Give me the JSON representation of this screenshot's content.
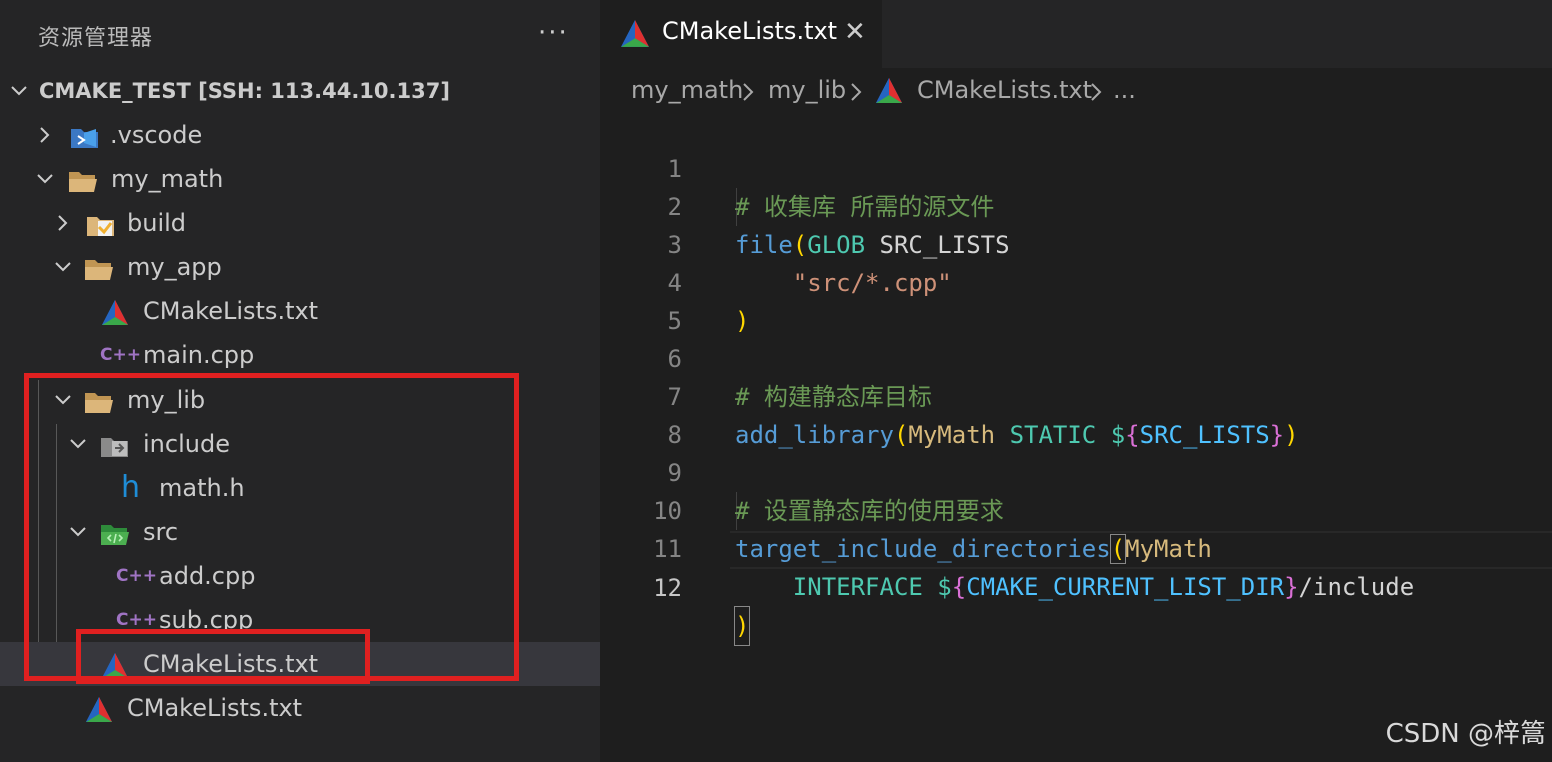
{
  "explorer": {
    "title": "资源管理器",
    "more_icon": "···",
    "tree": [
      {
        "label": "CMAKE_TEST [SSH: 113.44.10.137]",
        "icon": "none",
        "chevron": "down"
      },
      {
        "label": ".vscode",
        "icon": "vscode-folder-icon",
        "chevron": "right"
      },
      {
        "label": "my_math",
        "icon": "folder-open-icon",
        "chevron": "down"
      },
      {
        "label": "build",
        "icon": "build-folder-icon",
        "chevron": "right"
      },
      {
        "label": "my_app",
        "icon": "folder-open-icon",
        "chevron": "down"
      },
      {
        "label": "CMakeLists.txt",
        "icon": "cmake-icon",
        "chevron": "none"
      },
      {
        "label": "main.cpp",
        "icon": "cpp-icon",
        "chevron": "none"
      },
      {
        "label": "my_lib",
        "icon": "folder-open-icon",
        "chevron": "down"
      },
      {
        "label": "include",
        "icon": "include-folder-icon",
        "chevron": "down"
      },
      {
        "label": "math.h",
        "icon": "header-icon",
        "chevron": "none"
      },
      {
        "label": "src",
        "icon": "src-folder-icon",
        "chevron": "down"
      },
      {
        "label": "add.cpp",
        "icon": "cpp-icon",
        "chevron": "none"
      },
      {
        "label": "sub.cpp",
        "icon": "cpp-icon",
        "chevron": "none"
      },
      {
        "label": "CMakeLists.txt",
        "icon": "cmake-icon",
        "chevron": "none",
        "selected": true
      },
      {
        "label": "CMakeLists.txt",
        "icon": "cmake-icon",
        "chevron": "none"
      }
    ]
  },
  "editor": {
    "tab": {
      "label": "CMakeLists.txt",
      "close": "✕"
    },
    "breadcrumb": [
      "my_math",
      "my_lib",
      "CMakeLists.txt",
      "..."
    ],
    "current_line": 12,
    "lines": [
      {
        "n": "1",
        "text": "# 收集库 所需的源文件"
      },
      {
        "n": "2",
        "text": "file(GLOB SRC_LISTS"
      },
      {
        "n": "3",
        "text": "    \"src/*.cpp\""
      },
      {
        "n": "4",
        "text": ")"
      },
      {
        "n": "5",
        "text": ""
      },
      {
        "n": "6",
        "text": "# 构建静态库目标"
      },
      {
        "n": "7",
        "text": "add_library(MyMath STATIC ${SRC_LISTS})"
      },
      {
        "n": "8",
        "text": ""
      },
      {
        "n": "9",
        "text": "# 设置静态库的使用要求"
      },
      {
        "n": "10",
        "text": "target_include_directories(MyMath"
      },
      {
        "n": "11",
        "text": "    INTERFACE ${CMAKE_CURRENT_LIST_DIR}/include"
      },
      {
        "n": "12",
        "text": ")"
      }
    ]
  },
  "watermark": "CSDN @梓篙",
  "colors": {
    "annotation": "#e02020",
    "selection": "#37373d"
  }
}
